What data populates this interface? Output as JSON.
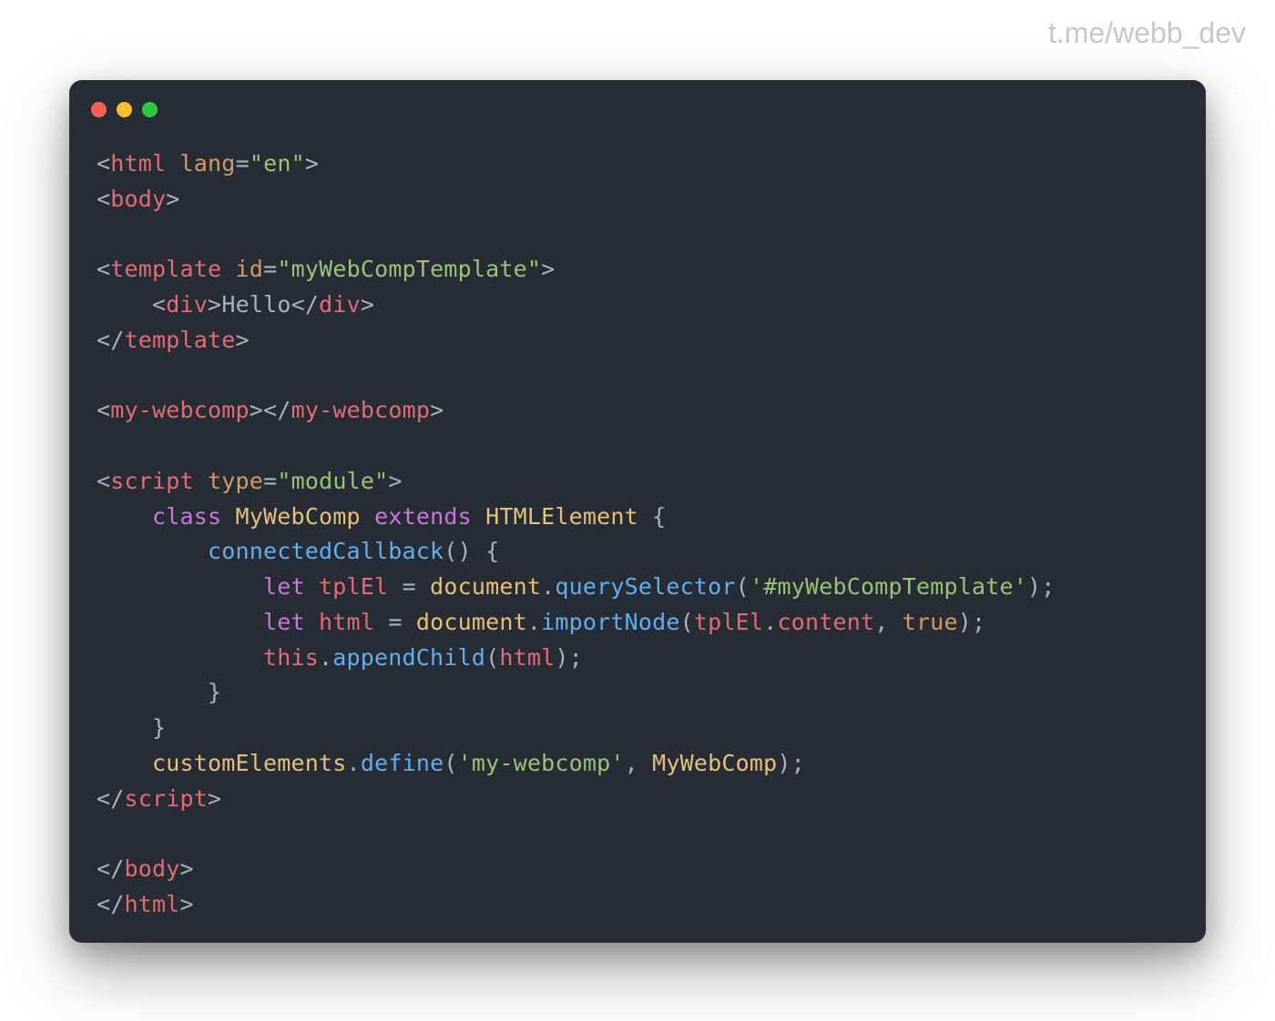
{
  "watermark": "t.me/webb_dev",
  "code": {
    "line1": {
      "bracket_open": "<",
      "tag_html": "html",
      "space": " ",
      "attr_lang": "lang",
      "eq": "=",
      "val_en": "\"en\"",
      "bracket_close": ">"
    },
    "line2": {
      "bracket_open": "<",
      "tag_body": "body",
      "bracket_close": ">"
    },
    "line4": {
      "bracket_open": "<",
      "tag_template": "template",
      "space": " ",
      "attr_id": "id",
      "eq": "=",
      "val_id": "\"myWebCompTemplate\"",
      "bracket_close": ">"
    },
    "line5": {
      "indent": "    ",
      "bracket_open": "<",
      "tag_div": "div",
      "bracket_close": ">",
      "text_hello": "Hello",
      "bracket_open2": "</",
      "tag_div2": "div",
      "bracket_close2": ">"
    },
    "line6": {
      "bracket_open": "</",
      "tag_template": "template",
      "bracket_close": ">"
    },
    "line8": {
      "bracket_open": "<",
      "tag_mywebcomp": "my-webcomp",
      "bracket_close": ">",
      "bracket_open2": "</",
      "tag_mywebcomp2": "my-webcomp",
      "bracket_close2": ">"
    },
    "line10": {
      "bracket_open": "<",
      "tag_script": "script",
      "space": " ",
      "attr_type": "type",
      "eq": "=",
      "val_module": "\"module\"",
      "bracket_close": ">"
    },
    "line11": {
      "indent": "    ",
      "kw_class": "class",
      "space1": " ",
      "cls_name": "MyWebComp",
      "space2": " ",
      "kw_extends": "extends",
      "space3": " ",
      "cls_parent": "HTMLElement",
      "space4": " ",
      "brace": "{"
    },
    "line12": {
      "indent": "        ",
      "fn_name": "connectedCallback",
      "parens": "()",
      "space": " ",
      "brace": "{"
    },
    "line13": {
      "indent": "            ",
      "kw_let": "let",
      "space1": " ",
      "var_tpl": "tplEl",
      "space2": " ",
      "eq": "=",
      "space3": " ",
      "obj_doc": "document",
      "dot": ".",
      "fn_qs": "querySelector",
      "paren_open": "(",
      "str_sel": "'#myWebCompTemplate'",
      "paren_close": ")",
      "semi": ";"
    },
    "line14": {
      "indent": "            ",
      "kw_let": "let",
      "space1": " ",
      "var_html": "html",
      "space2": " ",
      "eq": "=",
      "space3": " ",
      "obj_doc": "document",
      "dot": ".",
      "fn_import": "importNode",
      "paren_open": "(",
      "var_tpl": "tplEl",
      "dot2": ".",
      "prop_content": "content",
      "comma": ",",
      "space4": " ",
      "bool_true": "true",
      "paren_close": ")",
      "semi": ";"
    },
    "line15": {
      "indent": "            ",
      "kw_this": "this",
      "dot": ".",
      "fn_append": "appendChild",
      "paren_open": "(",
      "var_html": "html",
      "paren_close": ")",
      "semi": ";"
    },
    "line16": {
      "indent": "        ",
      "brace": "}"
    },
    "line17": {
      "indent": "    ",
      "brace": "}"
    },
    "line18": {
      "indent": "    ",
      "obj_ce": "customElements",
      "dot": ".",
      "fn_define": "define",
      "paren_open": "(",
      "str_name": "'my-webcomp'",
      "comma": ",",
      "space": " ",
      "cls_comp": "MyWebComp",
      "paren_close": ")",
      "semi": ";"
    },
    "line19": {
      "bracket_open": "</",
      "tag_script": "script",
      "bracket_close": ">"
    },
    "line21": {
      "bracket_open": "</",
      "tag_body": "body",
      "bracket_close": ">"
    },
    "line22": {
      "bracket_open": "</",
      "tag_html": "html",
      "bracket_close": ">"
    }
  }
}
